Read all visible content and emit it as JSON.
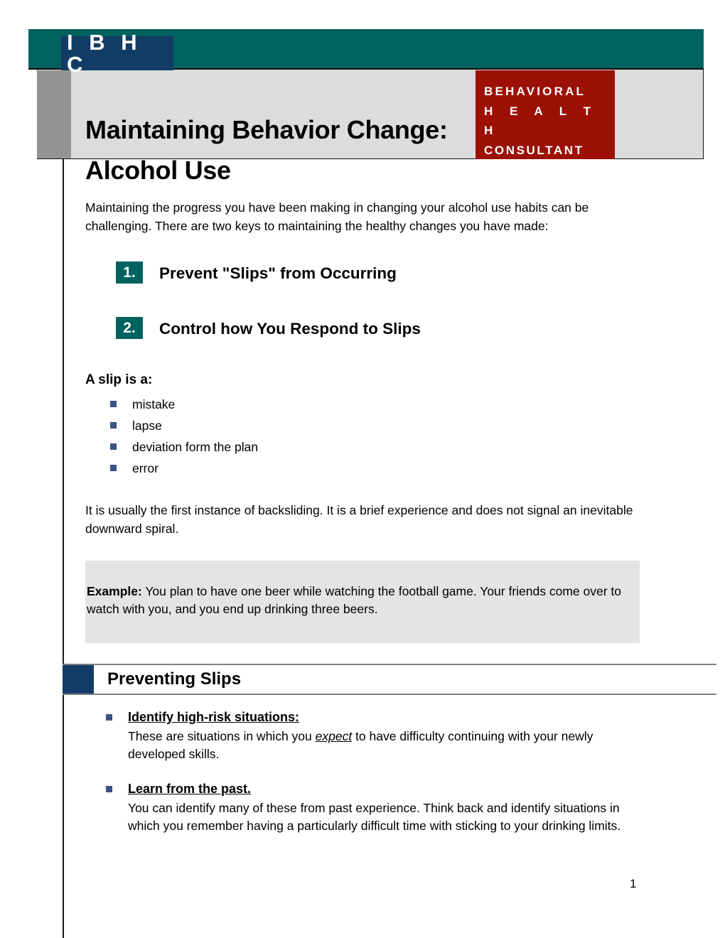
{
  "masthead": {
    "logo_text": "I B H C",
    "badge": {
      "line1": "BEHAVIORAL",
      "line2": "H E A L T H",
      "line3": "CONSULTANT"
    },
    "title": "Maintaining Behavior Change:  Alcohol Use"
  },
  "colors": {
    "teal_band": "#00625e",
    "logo_navy": "#123c66",
    "badge_red": "#9c1006",
    "header_gray": "#dcdcdc",
    "stripe_gray": "#949494",
    "bullet_blue": "#3d5182",
    "example_gray": "#e4e4e4",
    "rule_gray": "#808080"
  },
  "intro": "Maintaining the progress you have been making in changing your alcohol use habits can be challenging.  There are two keys to maintaining the healthy changes you have made:",
  "keys": [
    {
      "number": "1.",
      "label": "Prevent \"Slips\" from Occurring"
    },
    {
      "number": "2.",
      "label": "Control how You Respond to Slips"
    }
  ],
  "slip_definition": {
    "heading": "A slip is a:",
    "items": [
      "mistake",
      "lapse",
      "deviation form the plan",
      "error"
    ]
  },
  "backsliding_paragraph": "It is usually the first instance of backsliding.  It is a brief experience and does not signal an inevitable downward spiral.",
  "example": {
    "label": "Example:",
    "text": " You plan to have one beer while watching the football game.  Your friends come over to watch with you, and you end up drinking three beers."
  },
  "section": {
    "title": "Preventing Slips",
    "items": [
      {
        "heading": "Identify high-risk situations:",
        "text_before": "These are situations in which you ",
        "emphasis": "expect",
        "text_after": " to have difficulty continuing with your newly developed skills."
      },
      {
        "heading": "Learn from the past. ",
        "text_before": "You can identify many of these from past experience.  Think back and identify situations in which you remember having a particularly difficult time with sticking to your drinking limits.",
        "emphasis": "",
        "text_after": ""
      }
    ]
  },
  "footer": {
    "page_number": "1"
  }
}
